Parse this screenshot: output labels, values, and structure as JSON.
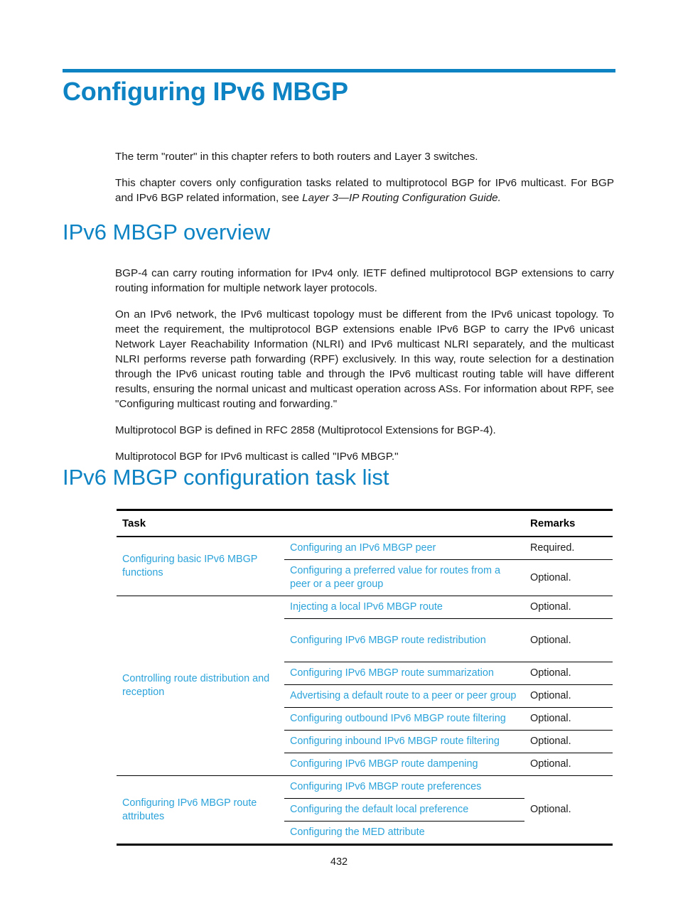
{
  "document": {
    "page_number": "432",
    "accent_color": "#0d83c4",
    "link_color": "#2ba3da",
    "chapter_title": "Configuring IPv6 MBGP"
  },
  "intro": {
    "paragraph_1": "The term \"router\" in this chapter refers to both routers and Layer 3 switches.",
    "paragraph_2_part_1": "This chapter covers only configuration tasks related to multiprotocol BGP for IPv6 multicast. For BGP and IPv6 BGP related information, see ",
    "paragraph_2_italic": "Layer 3—IP Routing Configuration Guide."
  },
  "overview": {
    "heading": "IPv6 MBGP overview",
    "paragraph_1": "BGP-4 can carry routing information for IPv4 only. IETF defined multiprotocol BGP extensions to carry routing information for multiple network layer protocols.",
    "paragraph_2": "On an IPv6 network, the IPv6 multicast topology must be different from the IPv6 unicast topology. To meet the requirement, the multiprotocol BGP extensions enable IPv6 BGP to carry the IPv6 unicast Network Layer Reachability Information (NLRI) and IPv6 multicast NLRI separately, and the multicast NLRI performs reverse path forwarding (RPF) exclusively. In this way, route selection for a destination through the IPv6 unicast routing table and through the IPv6 multicast routing table will have different results, ensuring the normal unicast and multicast operation across ASs. For information about RPF, see \"Configuring multicast routing and forwarding.\"",
    "paragraph_3": "Multiprotocol BGP is defined in RFC 2858 (Multiprotocol Extensions for BGP-4).",
    "paragraph_4": "Multiprotocol BGP for IPv6 multicast is called \"IPv6 MBGP.\""
  },
  "task_list": {
    "heading": "IPv6 MBGP configuration task list",
    "columns": {
      "task": "Task",
      "remarks": "Remarks"
    },
    "groups": [
      {
        "name": "Configuring basic IPv6 MBGP functions",
        "merged_remark": null,
        "rows": [
          {
            "task": "Configuring an IPv6 MBGP peer",
            "remark": "Required."
          },
          {
            "task": "Configuring a preferred value for routes from a peer or a peer group",
            "remark": "Optional."
          }
        ]
      },
      {
        "name": "Controlling route distribution and reception",
        "merged_remark": null,
        "rows": [
          {
            "task": "Injecting a local IPv6 MBGP route",
            "remark": "Optional."
          },
          {
            "task": "Configuring IPv6 MBGP route redistribution",
            "remark": "Optional."
          },
          {
            "task": "Configuring IPv6 MBGP route summarization",
            "remark": "Optional."
          },
          {
            "task": "Advertising a default route to a peer or peer group",
            "remark": "Optional."
          },
          {
            "task": "Configuring outbound IPv6 MBGP route filtering",
            "remark": "Optional."
          },
          {
            "task": "Configuring inbound IPv6 MBGP route filtering",
            "remark": "Optional."
          },
          {
            "task": "Configuring IPv6 MBGP route dampening",
            "remark": "Optional."
          }
        ]
      },
      {
        "name": "Configuring IPv6 MBGP route attributes",
        "merged_remark": "Optional.",
        "rows": [
          {
            "task": "Configuring IPv6 MBGP route preferences",
            "remark": null
          },
          {
            "task": "Configuring the default local preference",
            "remark": null
          },
          {
            "task": "Configuring the MED attribute",
            "remark": null
          }
        ]
      }
    ]
  }
}
